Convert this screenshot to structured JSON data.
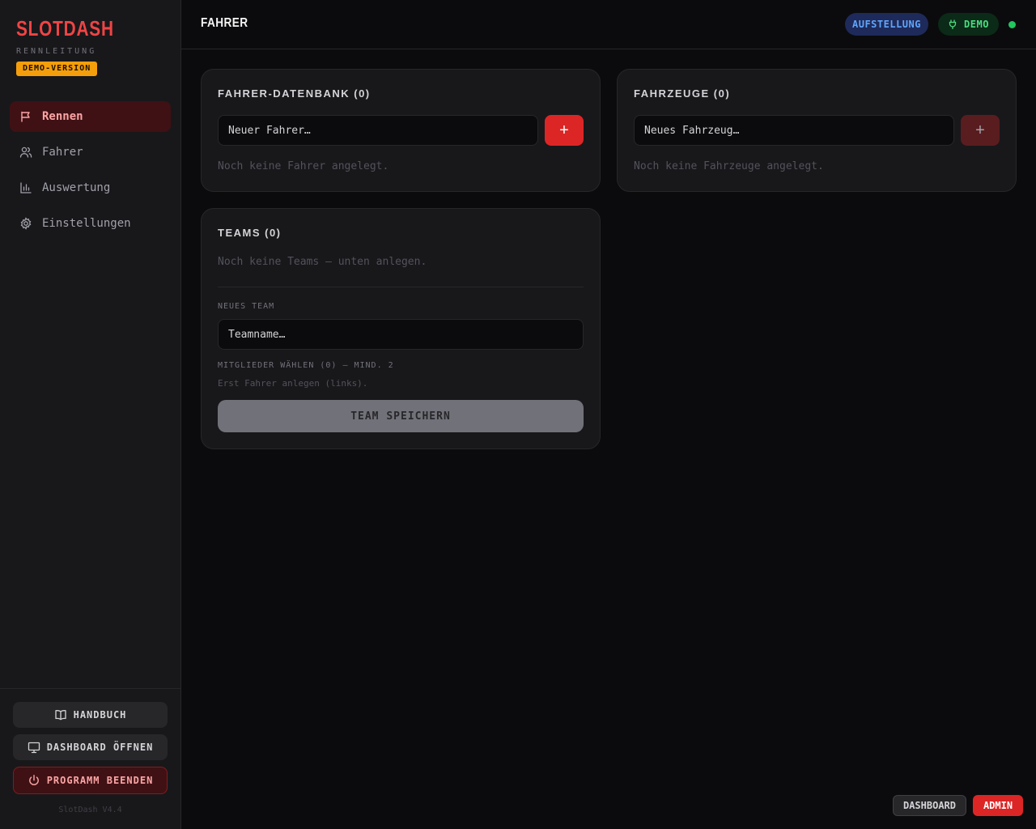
{
  "sidebar": {
    "brand": "SLOTDASH",
    "subtitle": "RENNLEITUNG",
    "demo_badge": "DEMO-VERSION",
    "nav": [
      {
        "label": "Rennen",
        "icon": "flag-icon",
        "active": true
      },
      {
        "label": "Fahrer",
        "icon": "users-icon",
        "active": false
      },
      {
        "label": "Auswertung",
        "icon": "bar-chart-icon",
        "active": false
      },
      {
        "label": "Einstellungen",
        "icon": "gear-icon",
        "active": false
      }
    ],
    "buttons": {
      "manual": "HANDBUCH",
      "dashboard": "DASHBOARD ÖFFNEN",
      "quit": "PROGRAMM BEENDEN"
    },
    "version": "SlotDash V4.4"
  },
  "header": {
    "title": "FAHRER",
    "status_pill": "AUFSTELLUNG",
    "mode_pill": "DEMO",
    "accent_colors": {
      "brand": "#ef4444",
      "connected": "#22c55e"
    }
  },
  "drivers_card": {
    "title": "FAHRER-DATENBANK (0)",
    "input_placeholder": "Neuer Fahrer…",
    "add_label": "+",
    "empty_text": "Noch keine Fahrer angelegt."
  },
  "vehicles_card": {
    "title": "FAHRZEUGE (0)",
    "input_placeholder": "Neues Fahrzeug…",
    "add_label": "+",
    "empty_text": "Noch keine Fahrzeuge angelegt."
  },
  "teams_card": {
    "title": "TEAMS (0)",
    "empty_text": "Noch keine Teams — unten anlegen.",
    "new_team_label": "NEUES TEAM",
    "team_name_placeholder": "Teamname…",
    "members_label": "MITGLIEDER WÄHLEN (0) — MIND. 2",
    "members_hint": "Erst Fahrer anlegen (links).",
    "save_label": "TEAM SPEICHERN"
  },
  "footer": {
    "dashboard": "DASHBOARD",
    "admin": "ADMIN"
  }
}
